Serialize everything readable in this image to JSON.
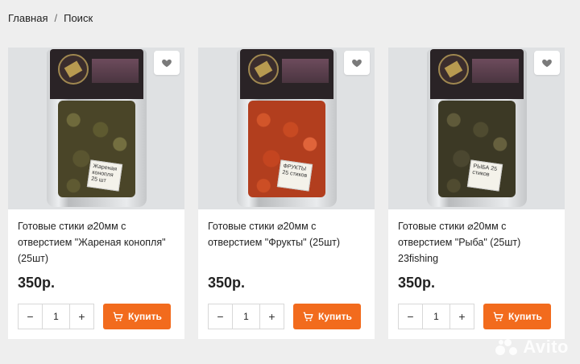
{
  "breadcrumb": {
    "home": "Главная",
    "separator": "/",
    "current": "Поиск"
  },
  "products": [
    {
      "title": "Готовые стики ⌀20мм с отверстием \"Жареная конопля\" (25шт)",
      "price": "350р.",
      "quantity": "1",
      "buy_label": "Купить",
      "pellet_color": "green",
      "sticker": "Жареная конопля 25 шт"
    },
    {
      "title": "Готовые стики ⌀20мм с отверстием \"Фрукты\" (25шт)",
      "price": "350р.",
      "quantity": "1",
      "buy_label": "Купить",
      "pellet_color": "red",
      "sticker": "ФРУКТЫ 25 стиков"
    },
    {
      "title": "Готовые стики ⌀20мм с отверстием \"Рыба\" (25шт) 23fishing",
      "price": "350р.",
      "quantity": "1",
      "buy_label": "Купить",
      "pellet_color": "dark",
      "sticker": "РЫБА 25 стиков"
    }
  ],
  "controls": {
    "minus": "−",
    "plus": "+"
  },
  "icons": {
    "favorite": "heart-icon",
    "cart": "cart-icon"
  },
  "colors": {
    "accent": "#f26b1d",
    "background": "#eeeeee"
  },
  "watermark": "Avito"
}
